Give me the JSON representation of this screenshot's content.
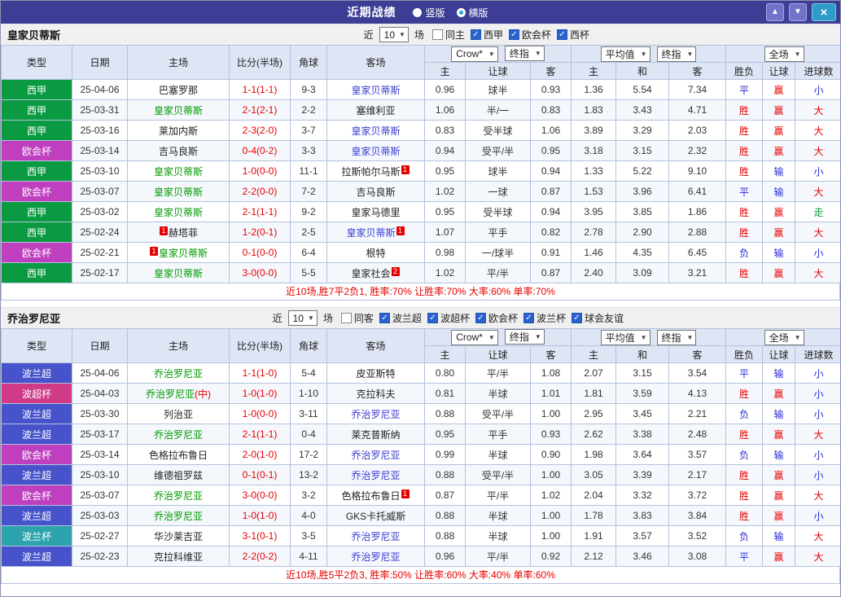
{
  "titlebar": {
    "title": "近期战绩",
    "vertical_label": "竖版",
    "horizontal_label": "横版"
  },
  "icons": {
    "check": "✓",
    "dropdown": "▼",
    "up": "▲",
    "down": "▼",
    "close": "×"
  },
  "colors": {
    "titlebar_bg": "#3d3d95",
    "header_bg": "#dee5f4",
    "border": "#b3c2dd",
    "row_alt_bg": "#f4f8fd",
    "toolbar_bg": "#f0f0f0",
    "home_team": "#009900",
    "away_team": "#3b3bd0",
    "score": "#e60000",
    "card_badge": "#e60000",
    "summary_text": "#e60000",
    "nav_btn": "#7272c8",
    "close_btn": "#2e9dc8",
    "result_red": "#e60000",
    "result_blue": "#2b2bd5",
    "result_green": "#0a9b42",
    "badge": {
      "西甲": "#0a9b42",
      "欧会杯": "#bf3fbf",
      "波兰超": "#4653cb",
      "波超杯": "#d03a86",
      "波兰杯": "#2da3ad"
    }
  },
  "sections": [
    {
      "team": "皇家贝蒂斯",
      "filter": {
        "near_label": "近",
        "count": "10",
        "games_label": "场",
        "options": [
          {
            "label": "同主",
            "checked": false
          },
          {
            "label": "西甲",
            "checked": true
          },
          {
            "label": "欧会杯",
            "checked": true
          },
          {
            "label": "西杯",
            "checked": true
          }
        ]
      },
      "columns_left": [
        "类型",
        "日期",
        "主场",
        "比分(半场)",
        "角球",
        "客场"
      ],
      "columns_sub": [
        "主",
        "让球",
        "客",
        "主",
        "和",
        "客",
        "胜负",
        "让球",
        "进球数"
      ],
      "select_groups": [
        {
          "selects": [
            {
              "name": "odds-company-select",
              "label": "Crow*"
            },
            {
              "name": "odds-stage-select",
              "label": "终指"
            }
          ]
        },
        {
          "selects": [
            {
              "name": "europe-type-select",
              "label": "平均值"
            },
            {
              "name": "europe-stage-select",
              "label": "终指"
            }
          ]
        },
        {
          "selects": [
            {
              "name": "scope-select",
              "label": "全场"
            }
          ]
        }
      ],
      "rows": [
        {
          "league": "西甲",
          "date": "25-04-06",
          "home": {
            "name": "巴塞罗那"
          },
          "score": "1-1(1-1)",
          "corners": "9-3",
          "away": {
            "name": "皇家贝蒂斯",
            "hl": "away"
          },
          "asian": [
            "0.96",
            "球半",
            "0.93"
          ],
          "europe": [
            "1.36",
            "5.54",
            "7.34"
          ],
          "results": [
            {
              "t": "平",
              "c": "blue"
            },
            {
              "t": "赢",
              "c": "red"
            },
            {
              "t": "小",
              "c": "blue"
            }
          ]
        },
        {
          "league": "西甲",
          "date": "25-03-31",
          "home": {
            "name": "皇家贝蒂斯",
            "hl": "home"
          },
          "score": "2-1(2-1)",
          "corners": "2-2",
          "away": {
            "name": "塞维利亚"
          },
          "asian": [
            "1.06",
            "半/一",
            "0.83"
          ],
          "europe": [
            "1.83",
            "3.43",
            "4.71"
          ],
          "results": [
            {
              "t": "胜",
              "c": "red"
            },
            {
              "t": "赢",
              "c": "red"
            },
            {
              "t": "大",
              "c": "red"
            }
          ]
        },
        {
          "league": "西甲",
          "date": "25-03-16",
          "home": {
            "name": "莱加内斯"
          },
          "score": "2-3(2-0)",
          "corners": "3-7",
          "away": {
            "name": "皇家贝蒂斯",
            "hl": "away"
          },
          "asian": [
            "0.83",
            "受半球",
            "1.06"
          ],
          "europe": [
            "3.89",
            "3.29",
            "2.03"
          ],
          "results": [
            {
              "t": "胜",
              "c": "red"
            },
            {
              "t": "赢",
              "c": "red"
            },
            {
              "t": "大",
              "c": "red"
            }
          ]
        },
        {
          "league": "欧会杯",
          "date": "25-03-14",
          "home": {
            "name": "吉马良斯"
          },
          "score": "0-4(0-2)",
          "corners": "3-3",
          "away": {
            "name": "皇家贝蒂斯",
            "hl": "away"
          },
          "asian": [
            "0.94",
            "受平/半",
            "0.95"
          ],
          "europe": [
            "3.18",
            "3.15",
            "2.32"
          ],
          "results": [
            {
              "t": "胜",
              "c": "red"
            },
            {
              "t": "赢",
              "c": "red"
            },
            {
              "t": "大",
              "c": "red"
            }
          ]
        },
        {
          "league": "西甲",
          "date": "25-03-10",
          "home": {
            "name": "皇家贝蒂斯",
            "hl": "home"
          },
          "score": "1-0(0-0)",
          "corners": "11-1",
          "away": {
            "name": "拉斯帕尔马斯",
            "card": "1",
            "card_pos": "after"
          },
          "asian": [
            "0.95",
            "球半",
            "0.94"
          ],
          "europe": [
            "1.33",
            "5.22",
            "9.10"
          ],
          "results": [
            {
              "t": "胜",
              "c": "red"
            },
            {
              "t": "输",
              "c": "blue"
            },
            {
              "t": "小",
              "c": "blue"
            }
          ]
        },
        {
          "league": "欧会杯",
          "date": "25-03-07",
          "home": {
            "name": "皇家贝蒂斯",
            "hl": "home"
          },
          "score": "2-2(0-0)",
          "corners": "7-2",
          "away": {
            "name": "吉马良斯"
          },
          "asian": [
            "1.02",
            "一球",
            "0.87"
          ],
          "europe": [
            "1.53",
            "3.96",
            "6.41"
          ],
          "results": [
            {
              "t": "平",
              "c": "blue"
            },
            {
              "t": "输",
              "c": "blue"
            },
            {
              "t": "大",
              "c": "red"
            }
          ]
        },
        {
          "league": "西甲",
          "date": "25-03-02",
          "home": {
            "name": "皇家贝蒂斯",
            "hl": "home"
          },
          "score": "2-1(1-1)",
          "corners": "9-2",
          "away": {
            "name": "皇家马德里"
          },
          "asian": [
            "0.95",
            "受半球",
            "0.94"
          ],
          "europe": [
            "3.95",
            "3.85",
            "1.86"
          ],
          "results": [
            {
              "t": "胜",
              "c": "red"
            },
            {
              "t": "赢",
              "c": "red"
            },
            {
              "t": "走",
              "c": "green"
            }
          ]
        },
        {
          "league": "西甲",
          "date": "25-02-24",
          "home": {
            "name": "赫塔菲",
            "card": "1",
            "card_pos": "before"
          },
          "score": "1-2(0-1)",
          "corners": "2-5",
          "away": {
            "name": "皇家贝蒂斯",
            "hl": "away",
            "card": "1",
            "card_pos": "after"
          },
          "asian": [
            "1.07",
            "平手",
            "0.82"
          ],
          "europe": [
            "2.78",
            "2.90",
            "2.88"
          ],
          "results": [
            {
              "t": "胜",
              "c": "red"
            },
            {
              "t": "赢",
              "c": "red"
            },
            {
              "t": "大",
              "c": "red"
            }
          ]
        },
        {
          "league": "欧会杯",
          "date": "25-02-21",
          "home": {
            "name": "皇家贝蒂斯",
            "hl": "home",
            "card": "1",
            "card_pos": "before"
          },
          "score": "0-1(0-0)",
          "corners": "6-4",
          "away": {
            "name": "根特"
          },
          "asian": [
            "0.98",
            "一/球半",
            "0.91"
          ],
          "europe": [
            "1.46",
            "4.35",
            "6.45"
          ],
          "results": [
            {
              "t": "负",
              "c": "blue"
            },
            {
              "t": "输",
              "c": "blue"
            },
            {
              "t": "小",
              "c": "blue"
            }
          ]
        },
        {
          "league": "西甲",
          "date": "25-02-17",
          "home": {
            "name": "皇家贝蒂斯",
            "hl": "home"
          },
          "score": "3-0(0-0)",
          "corners": "5-5",
          "away": {
            "name": "皇家社会",
            "card": "2",
            "card_pos": "after"
          },
          "asian": [
            "1.02",
            "平/半",
            "0.87"
          ],
          "europe": [
            "2.40",
            "3.09",
            "3.21"
          ],
          "results": [
            {
              "t": "胜",
              "c": "red"
            },
            {
              "t": "赢",
              "c": "red"
            },
            {
              "t": "大",
              "c": "red"
            }
          ]
        }
      ],
      "summary": "近10场,胜7平2负1, 胜率:70% 让胜率:70% 大率:60% 单率:70%"
    },
    {
      "team": "乔治罗尼亚",
      "filter": {
        "near_label": "近",
        "count": "10",
        "games_label": "场",
        "options": [
          {
            "label": "同客",
            "checked": false
          },
          {
            "label": "波兰超",
            "checked": true
          },
          {
            "label": "波超杯",
            "checked": true
          },
          {
            "label": "欧会杯",
            "checked": true
          },
          {
            "label": "波兰杯",
            "checked": true
          },
          {
            "label": "球会友谊",
            "checked": true
          }
        ]
      },
      "columns_left": [
        "类型",
        "日期",
        "主场",
        "比分(半场)",
        "角球",
        "客场"
      ],
      "columns_sub": [
        "主",
        "让球",
        "客",
        "主",
        "和",
        "客",
        "胜负",
        "让球",
        "进球数"
      ],
      "select_groups": [
        {
          "selects": [
            {
              "name": "odds-company-select",
              "label": "Crow*"
            },
            {
              "name": "odds-stage-select",
              "label": "终指"
            }
          ]
        },
        {
          "selects": [
            {
              "name": "europe-type-select",
              "label": "平均值"
            },
            {
              "name": "europe-stage-select",
              "label": "终指"
            }
          ]
        },
        {
          "selects": [
            {
              "name": "scope-select",
              "label": "全场"
            }
          ]
        }
      ],
      "rows": [
        {
          "league": "波兰超",
          "date": "25-04-06",
          "home": {
            "name": "乔治罗尼亚",
            "hl": "home"
          },
          "score": "1-1(1-0)",
          "corners": "5-4",
          "away": {
            "name": "皮亚斯特"
          },
          "asian": [
            "0.80",
            "平/半",
            "1.08"
          ],
          "europe": [
            "2.07",
            "3.15",
            "3.54"
          ],
          "results": [
            {
              "t": "平",
              "c": "blue"
            },
            {
              "t": "输",
              "c": "blue"
            },
            {
              "t": "小",
              "c": "blue"
            }
          ]
        },
        {
          "league": "波超杯",
          "date": "25-04-03",
          "home": {
            "name": "乔治罗尼亚",
            "hl": "home",
            "suffix": "(中)"
          },
          "score": "1-0(1-0)",
          "corners": "1-10",
          "away": {
            "name": "克拉科夫"
          },
          "asian": [
            "0.81",
            "半球",
            "1.01"
          ],
          "europe": [
            "1.81",
            "3.59",
            "4.13"
          ],
          "results": [
            {
              "t": "胜",
              "c": "red"
            },
            {
              "t": "赢",
              "c": "red"
            },
            {
              "t": "小",
              "c": "blue"
            }
          ]
        },
        {
          "league": "波兰超",
          "date": "25-03-30",
          "home": {
            "name": "列治亚"
          },
          "score": "1-0(0-0)",
          "corners": "3-11",
          "away": {
            "name": "乔治罗尼亚",
            "hl": "away"
          },
          "asian": [
            "0.88",
            "受平/半",
            "1.00"
          ],
          "europe": [
            "2.95",
            "3.45",
            "2.21"
          ],
          "results": [
            {
              "t": "负",
              "c": "blue"
            },
            {
              "t": "输",
              "c": "blue"
            },
            {
              "t": "小",
              "c": "blue"
            }
          ]
        },
        {
          "league": "波兰超",
          "date": "25-03-17",
          "home": {
            "name": "乔治罗尼亚",
            "hl": "home"
          },
          "score": "2-1(1-1)",
          "corners": "0-4",
          "away": {
            "name": "莱克普斯纳"
          },
          "asian": [
            "0.95",
            "平手",
            "0.93"
          ],
          "europe": [
            "2.62",
            "3.38",
            "2.48"
          ],
          "results": [
            {
              "t": "胜",
              "c": "red"
            },
            {
              "t": "赢",
              "c": "red"
            },
            {
              "t": "大",
              "c": "red"
            }
          ]
        },
        {
          "league": "欧会杯",
          "date": "25-03-14",
          "home": {
            "name": "色格拉布鲁日"
          },
          "score": "2-0(1-0)",
          "corners": "17-2",
          "away": {
            "name": "乔治罗尼亚",
            "hl": "away"
          },
          "asian": [
            "0.99",
            "半球",
            "0.90"
          ],
          "europe": [
            "1.98",
            "3.64",
            "3.57"
          ],
          "results": [
            {
              "t": "负",
              "c": "blue"
            },
            {
              "t": "输",
              "c": "blue"
            },
            {
              "t": "小",
              "c": "blue"
            }
          ]
        },
        {
          "league": "波兰超",
          "date": "25-03-10",
          "home": {
            "name": "维德祖罗兹"
          },
          "score": "0-1(0-1)",
          "corners": "13-2",
          "away": {
            "name": "乔治罗尼亚",
            "hl": "away"
          },
          "asian": [
            "0.88",
            "受平/半",
            "1.00"
          ],
          "europe": [
            "3.05",
            "3.39",
            "2.17"
          ],
          "results": [
            {
              "t": "胜",
              "c": "red"
            },
            {
              "t": "赢",
              "c": "red"
            },
            {
              "t": "小",
              "c": "blue"
            }
          ]
        },
        {
          "league": "欧会杯",
          "date": "25-03-07",
          "home": {
            "name": "乔治罗尼亚",
            "hl": "home"
          },
          "score": "3-0(0-0)",
          "corners": "3-2",
          "away": {
            "name": "色格拉布鲁日",
            "card": "1",
            "card_pos": "after"
          },
          "asian": [
            "0.87",
            "平/半",
            "1.02"
          ],
          "europe": [
            "2.04",
            "3.32",
            "3.72"
          ],
          "results": [
            {
              "t": "胜",
              "c": "red"
            },
            {
              "t": "赢",
              "c": "red"
            },
            {
              "t": "大",
              "c": "red"
            }
          ]
        },
        {
          "league": "波兰超",
          "date": "25-03-03",
          "home": {
            "name": "乔治罗尼亚",
            "hl": "home"
          },
          "score": "1-0(1-0)",
          "corners": "4-0",
          "away": {
            "name": "GKS卡托威斯"
          },
          "asian": [
            "0.88",
            "半球",
            "1.00"
          ],
          "europe": [
            "1.78",
            "3.83",
            "3.84"
          ],
          "results": [
            {
              "t": "胜",
              "c": "red"
            },
            {
              "t": "赢",
              "c": "red"
            },
            {
              "t": "小",
              "c": "blue"
            }
          ]
        },
        {
          "league": "波兰杯",
          "date": "25-02-27",
          "home": {
            "name": "华沙莱吉亚"
          },
          "score": "3-1(0-1)",
          "corners": "3-5",
          "away": {
            "name": "乔治罗尼亚",
            "hl": "away"
          },
          "asian": [
            "0.88",
            "半球",
            "1.00"
          ],
          "europe": [
            "1.91",
            "3.57",
            "3.52"
          ],
          "results": [
            {
              "t": "负",
              "c": "blue"
            },
            {
              "t": "输",
              "c": "blue"
            },
            {
              "t": "大",
              "c": "red"
            }
          ]
        },
        {
          "league": "波兰超",
          "date": "25-02-23",
          "home": {
            "name": "克拉科维亚"
          },
          "score": "2-2(0-2)",
          "corners": "4-11",
          "away": {
            "name": "乔治罗尼亚",
            "hl": "away"
          },
          "asian": [
            "0.96",
            "平/半",
            "0.92"
          ],
          "europe": [
            "2.12",
            "3.46",
            "3.08"
          ],
          "results": [
            {
              "t": "平",
              "c": "blue"
            },
            {
              "t": "赢",
              "c": "red"
            },
            {
              "t": "大",
              "c": "red"
            }
          ]
        }
      ],
      "summary": "近10场,胜5平2负3, 胜率:50% 让胜率:60% 大率:40% 单率:60%"
    }
  ]
}
